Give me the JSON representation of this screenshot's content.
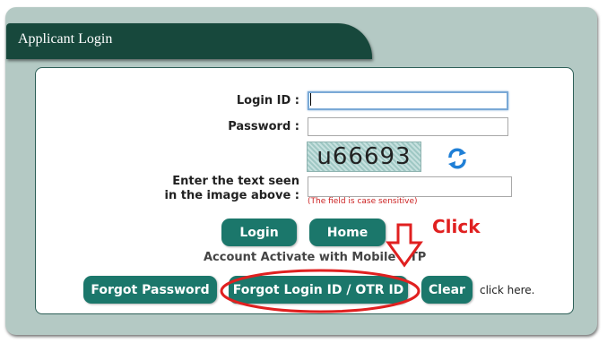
{
  "header": {
    "title": "Applicant Login"
  },
  "form": {
    "login_id_label": "Login ID :",
    "login_id_value": "",
    "password_label": "Password :",
    "password_value": "",
    "captcha_label_line1": "Enter the text seen",
    "captcha_label_line2": "in the image above :",
    "captcha_text": "u66693",
    "captcha_value": "",
    "captcha_hint": "(The field is case sensitive)"
  },
  "buttons": {
    "login": "Login",
    "home": "Home",
    "forgot_password": "Forgot Password",
    "forgot_login_id": "Forgot Login ID / OTR ID",
    "clear": "Clear"
  },
  "account_activate": "Account Activate with Mobile OTP",
  "click_here": "click here.",
  "annotation": {
    "text": "Click",
    "color": "#e02020"
  },
  "colors": {
    "panel": "#b4c9c4",
    "header": "#17483c",
    "button": "#1b776b"
  },
  "icons": {
    "refresh": "refresh-icon"
  }
}
